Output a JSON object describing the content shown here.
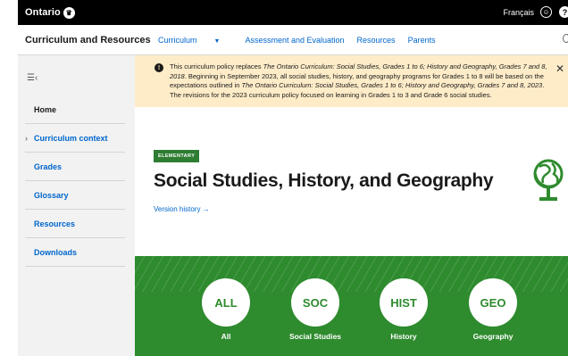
{
  "topbar": {
    "logo": "Ontario",
    "logo_mark": "♛",
    "language": "Français",
    "account_icon": "☺",
    "help_icon": "?"
  },
  "subnav": {
    "site_title": "Curriculum and Resources",
    "links": [
      "Curriculum",
      "Assessment and Evaluation",
      "Resources",
      "Parents"
    ]
  },
  "sidebar": {
    "items": [
      {
        "label": "Home"
      },
      {
        "label": "Curriculum context",
        "expandable": true
      },
      {
        "label": "Grades"
      },
      {
        "label": "Glossary"
      },
      {
        "label": "Resources"
      },
      {
        "label": "Downloads"
      }
    ]
  },
  "alert": {
    "part1": "This curriculum policy replaces ",
    "italic1": "The Ontario Curriculum: Social Studies, Grades 1 to 6; History and Geography, Grades 7 and 8, 2018",
    "part2": ". Beginning in September 2023, all social studies, history, and geography programs for Grades 1 to 8 will be based on the expectations outlined in ",
    "italic2": "The Ontario Curriculum: Social Studies, Grades 1 to 6; History and Geography, Grades 7 and 8, 2023",
    "part3": ". The revisions for the 2023 curriculum policy focused on learning in Grades 1 to 3 and Grade 6 social studies.",
    "close": "✕"
  },
  "main": {
    "badge": "ELEMENTARY",
    "title": "Social Studies, History, and Geography",
    "version_link": "Version history →"
  },
  "subjects": [
    {
      "abbr": "ALL",
      "label": "All"
    },
    {
      "abbr": "SOC",
      "label": "Social Studies"
    },
    {
      "abbr": "HIST",
      "label": "History"
    },
    {
      "abbr": "GEO",
      "label": "Geography"
    }
  ],
  "colors": {
    "green": "#2e8b2e",
    "badge_green": "#2e7d32",
    "alert_bg": "#feecc8",
    "link_blue": "#0066cc"
  }
}
